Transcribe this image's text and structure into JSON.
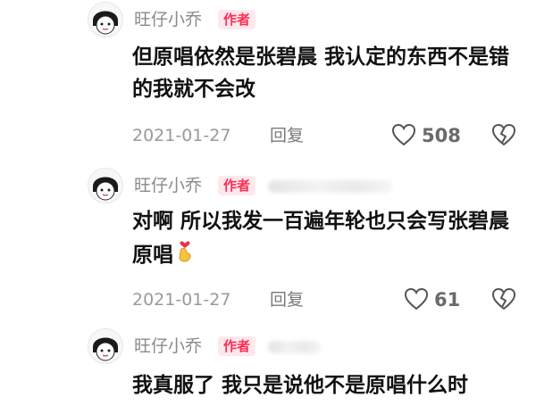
{
  "comments": [
    {
      "author": "旺仔小乔",
      "badge": "作者",
      "text": "但原唱依然是张碧晨 我认定的东西不是错的我就不会改",
      "date": "2021-01-27",
      "reply_label": "回复",
      "likes": "508"
    },
    {
      "author": "旺仔小乔",
      "badge": "作者",
      "text": "对啊 所以我发一百遍年轮也只会写张碧晨原唱",
      "date": "2021-01-27",
      "reply_label": "回复",
      "likes": "61"
    },
    {
      "author": "旺仔小乔",
      "badge": "作者",
      "text": "我真服了 我只是说他不是原唱什么时"
    }
  ],
  "icons": {
    "like": "heart-outline-icon",
    "dislike": "broken-heart-icon",
    "emoji": "finger-heart-emoji"
  },
  "colors": {
    "badge_bg": "#fde9ec",
    "badge_text": "#fe2c55"
  }
}
